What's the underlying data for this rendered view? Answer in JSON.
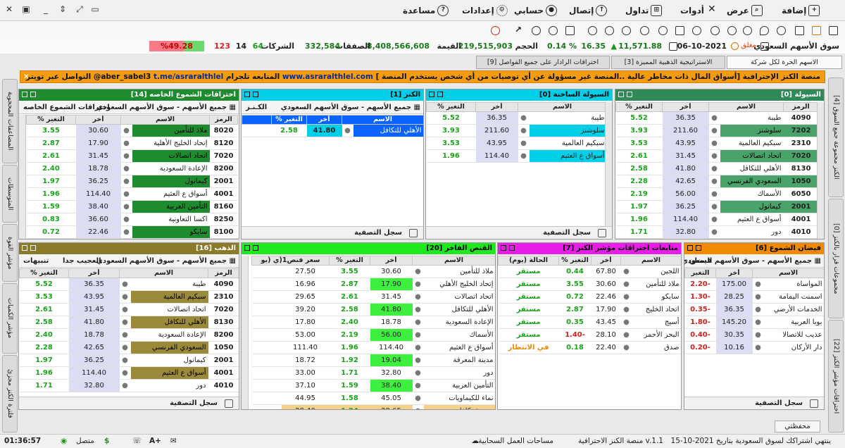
{
  "menu": [
    {
      "label": "إضافة",
      "icon": "plus-square-icon"
    },
    {
      "label": "عرض",
      "icon": "view-icon"
    },
    {
      "label": "أدوات",
      "icon": "tools-icon"
    },
    {
      "label": "تداول",
      "icon": "cart-icon"
    },
    {
      "label": "إتصال",
      "icon": "connect-icon"
    },
    {
      "label": "حسابي",
      "icon": "user-icon"
    },
    {
      "label": "إعدادات",
      "icon": "gear-icon"
    },
    {
      "label": "مساعدة",
      "icon": "help-icon"
    }
  ],
  "market": {
    "name": "سوق الأسهم السعودي",
    "status": "مغلق",
    "date": "06-10-2021",
    "index": "11,571.88",
    "change": "16.35",
    "change_pct": "0.14 %",
    "volume_label": "الحجم",
    "volume": "219,515,903",
    "value_label": "القيمة",
    "value": "8,408,566,608",
    "deals_label": "الصفقات",
    "deals": "332,584",
    "companies_label": "الشركات",
    "up": "64",
    "unchanged": "14",
    "down": "123",
    "ratio": "%49.28"
  },
  "tabs": [
    {
      "label": "الاسهم الحرة لكل شركة"
    },
    {
      "label": "الاستراتيجية الذهبية المميزة [3]"
    },
    {
      "label": "اختراقات الرادار على جميع الفواصل [9]"
    }
  ],
  "ticker": {
    "text": "منصة الكنز الإحترافية [أسواق المال ذات مخاطر عالية ..المنصة غير مسؤولة عن أي توصيات من أي شخص يستخدم المنصة ]",
    "site": "www.asraralthlel.com",
    "follow": "المتابعه تلجرام",
    "telegram": "t.me/asraralthlel",
    "twitter": "التواصل عبر تويتر @aber_sabel3"
  },
  "side_right": [
    {
      "label": "[4] الكنز مجموعة جمع السوق"
    },
    {
      "label": "[0] مجموعات قرار بالكنز"
    },
    {
      "label": "[22] اختراقات مؤشر الكنز"
    }
  ],
  "side_left": [
    {
      "label": "المضاعفات المحجوبة"
    },
    {
      "label": "المتوسطات"
    },
    {
      "label": "مؤشر القوة"
    },
    {
      "label": "مؤشر الكميات"
    },
    {
      "label": "فلترة الكنز مجزئ"
    }
  ],
  "common": {
    "all_stocks": "جميع الأسهم - سوق الأسهم السعودي",
    "footer": "سجل التصفية",
    "col_sym": "الرمز",
    "col_name": "الاسم",
    "col_last": "أخر",
    "col_chg": "التغير %",
    "col_chg2": "التغير"
  },
  "p_liquidity": {
    "title": "السيولة [0]",
    "rows": [
      {
        "sym": "4090",
        "name": "طيبة",
        "last": "36.35",
        "chg": "5.52"
      },
      {
        "sym": "7202",
        "name": "سلوشنز",
        "last": "211.60",
        "chg": "3.93"
      },
      {
        "sym": "2310",
        "name": "سبكيم العالمية",
        "last": "43.95",
        "chg": "3.53"
      },
      {
        "sym": "7020",
        "name": "اتحاد اتصالات",
        "last": "31.45",
        "chg": "2.61"
      },
      {
        "sym": "8130",
        "name": "الأهلي للتكافل",
        "last": "41.80",
        "chg": "2.58"
      },
      {
        "sym": "1050",
        "name": "السعودي الفرنسي",
        "last": "42.65",
        "chg": "2.28"
      },
      {
        "sym": "6050",
        "name": "الأسماك",
        "last": "56.00",
        "chg": "2.19"
      },
      {
        "sym": "2001",
        "name": "كيمانول",
        "last": "36.25",
        "chg": "1.97"
      },
      {
        "sym": "4001",
        "name": "أسواق ع العثيم",
        "last": "114.40",
        "chg": "1.96"
      },
      {
        "sym": "4010",
        "name": "دور",
        "last": "32.80",
        "chg": "1.71"
      }
    ]
  },
  "p_hot": {
    "title": "السيولة الساخنة [0]",
    "rows": [
      {
        "name": "طيبة",
        "last": "36.35",
        "chg": "5.52"
      },
      {
        "name": "سلوشنز",
        "last": "211.60",
        "chg": "3.93"
      },
      {
        "name": "سبكيم العالمية",
        "last": "43.95",
        "chg": "3.53"
      },
      {
        "name": "أسواق ع العثيم",
        "last": "114.40",
        "chg": "1.96"
      }
    ]
  },
  "p_treasure": {
    "title": "الكنز [1]",
    "filter": "الكـنـز",
    "rows": [
      {
        "name": "الأهلي للتكافل",
        "last": "41.80",
        "chg": "2.58"
      }
    ]
  },
  "p_candles": {
    "title": "اختراقات الشموع الخاصه [14]",
    "filter": "اختراقات الشموع الخاصه",
    "rows": [
      {
        "sym": "8020",
        "name": "ملاذ للتأمين",
        "last": "30.60",
        "chg": "3.55"
      },
      {
        "sym": "8120",
        "name": "إتحاد الخليج الأهلية",
        "last": "17.90",
        "chg": "2.87"
      },
      {
        "sym": "7020",
        "name": "اتحاد اتصالات",
        "last": "31.45",
        "chg": "2.61"
      },
      {
        "sym": "8200",
        "name": "الإعادة السعودية",
        "last": "18.78",
        "chg": "2.40"
      },
      {
        "sym": "2001",
        "name": "كيمانول",
        "last": "36.25",
        "chg": "1.97"
      },
      {
        "sym": "4001",
        "name": "أسواق ع العثيم",
        "last": "114.40",
        "chg": "1.96"
      },
      {
        "sym": "8160",
        "name": "التأمين العربية",
        "last": "38.40",
        "chg": "1.59"
      },
      {
        "sym": "8250",
        "name": "اكسا التعاونية",
        "last": "36.60",
        "chg": "0.83"
      },
      {
        "sym": "8100",
        "name": "سايكو",
        "last": "22.46",
        "chg": "0.72"
      }
    ]
  },
  "p_candle_surge": {
    "title": "فيضان الشموع [6]",
    "filter": "فيضان",
    "rows": [
      {
        "name": "المواساة",
        "last": "175.00",
        "chg": "-2.20"
      },
      {
        "name": "اسمنت اليمامة",
        "last": "28.25",
        "chg": "-1.30"
      },
      {
        "name": "الخدمات الأرضي",
        "last": "36.35",
        "chg": "-0.35"
      },
      {
        "name": "بوبا العربية",
        "last": "145.20",
        "chg": "-1.80"
      },
      {
        "name": "عذيب للاتصالا",
        "last": "30.35",
        "chg": "-0.40"
      },
      {
        "name": "دار الأركان",
        "last": "10.16",
        "chg": "-0.20"
      }
    ]
  },
  "p_followup": {
    "title": "متابعات اختراقات مؤشر الكنز [7]",
    "col_state": "الحالة (يوم)",
    "rows": [
      {
        "name": "اللجين",
        "last": "67.80",
        "chg": "0.44",
        "state": "مستقر",
        "cls": "g"
      },
      {
        "name": "ملاذ للتأمين",
        "last": "30.60",
        "chg": "3.55",
        "state": "مستقر",
        "cls": "g"
      },
      {
        "name": "سايكو",
        "last": "22.46",
        "chg": "0.72",
        "state": "مستقر",
        "cls": "g"
      },
      {
        "name": "اتحاد الخليج",
        "last": "17.90",
        "chg": "2.87",
        "state": "مستقر",
        "cls": "g"
      },
      {
        "name": "أسيج",
        "last": "43.45",
        "chg": "0.35",
        "state": "مستقر",
        "cls": "g"
      },
      {
        "name": "البحر الأحمر",
        "last": "28.10",
        "chg": "-1.40",
        "state": "مستقر",
        "cls": "g"
      },
      {
        "name": "صدق",
        "last": "22.40",
        "chg": "0.18",
        "state": "في الانتظار",
        "cls": "o"
      }
    ]
  },
  "p_hunter": {
    "title": "القنص الفاخر [20]",
    "col_price": "سعر قنص1(ي (يو",
    "rows": [
      {
        "name": "ملاذ للتأمين",
        "last": "30.60",
        "chg": "3.55",
        "price": "27.50"
      },
      {
        "name": "إتحاد الخليج الأهلي",
        "last": "17.90",
        "chg": "2.87",
        "price": "16.96"
      },
      {
        "name": "اتحاد اتصالات",
        "last": "31.45",
        "chg": "2.61",
        "price": "29.65"
      },
      {
        "name": "الأهلي للتكافل",
        "last": "41.80",
        "chg": "2.58",
        "price": "39.20"
      },
      {
        "name": "الإعادة السعودية",
        "last": "18.78",
        "chg": "2.40",
        "price": "17.80"
      },
      {
        "name": "الأسماك",
        "last": "56.00",
        "chg": "2.19",
        "price": "53.00"
      },
      {
        "name": "أسواق ع العثيم",
        "last": "114.40",
        "chg": "1.96",
        "price": "111.40"
      },
      {
        "name": "مدينة المعرفة",
        "last": "19.04",
        "chg": "1.92",
        "price": "18.72"
      },
      {
        "name": "دور",
        "last": "32.80",
        "chg": "1.71",
        "price": "33.00"
      },
      {
        "name": "التأمين العربية",
        "last": "38.40",
        "chg": "1.59",
        "price": "37.10"
      },
      {
        "name": "نماء للكيماويات",
        "last": "45.05",
        "chg": "1.58",
        "price": "44.95"
      },
      {
        "name": "جزيرة تكافل",
        "last": "28.65",
        "chg": "1.24",
        "price": "28.40"
      }
    ]
  },
  "p_gold": {
    "title": "الذهب [16]",
    "filter": "العجيب جدا",
    "alerts": "تنبيهات",
    "rows": [
      {
        "sym": "4090",
        "name": "طيبة",
        "last": "36.35",
        "chg": "5.52"
      },
      {
        "sym": "2310",
        "name": "سبكيم العالمية",
        "last": "43.95",
        "chg": "3.53"
      },
      {
        "sym": "7020",
        "name": "اتحاد اتصالات",
        "last": "31.45",
        "chg": "2.61"
      },
      {
        "sym": "8130",
        "name": "الأهلي للتكافل",
        "last": "41.80",
        "chg": "2.58"
      },
      {
        "sym": "8200",
        "name": "الإعادة السعودية",
        "last": "18.78",
        "chg": "2.40"
      },
      {
        "sym": "1050",
        "name": "السعودي الفرنسي",
        "last": "42.65",
        "chg": "2.28"
      },
      {
        "sym": "2001",
        "name": "كيمانول",
        "last": "36.25",
        "chg": "1.97"
      },
      {
        "sym": "4001",
        "name": "أسواق ع العثيم",
        "last": "114.40",
        "chg": "1.96"
      },
      {
        "sym": "4010",
        "name": "دور",
        "last": "32.80",
        "chg": "1.71"
      }
    ]
  },
  "portfolio_button": "محفظتي",
  "status": {
    "subscription": "ينتهي اشتراكك لسوق السعودية بتاريخ 2021-10-15",
    "platform": "منصة الكنز الاحترافية v.1.1",
    "cloud": "مساحات العمل السحابية",
    "font": "A+",
    "connected": "متصل",
    "time": "01:36:57"
  },
  "colors": {
    "liquidity": "#2e8b57",
    "hot": "#00cfe8",
    "treasure": "#00cfe8",
    "candles": "#1e8b2e",
    "surge": "#f08a00",
    "followup": "#e81ee8",
    "hunter": "#1ee81e",
    "gold": "#8b7a2a"
  }
}
